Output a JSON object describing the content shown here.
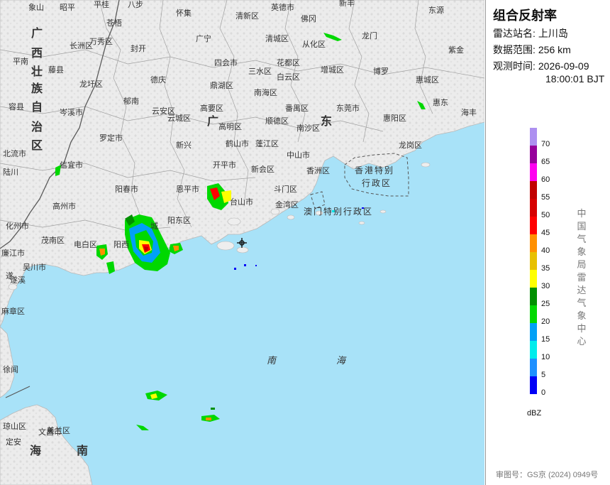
{
  "panel": {
    "title": "组合反射率",
    "station_label": "雷达站名:",
    "station_value": "上川岛",
    "range_label": "数据范围:",
    "range_value": "256 km",
    "time_label": "观测时间:",
    "time_date": "2026-09-09",
    "time_clock": "18:00:01 BJT",
    "legend_values": [
      "70",
      "65",
      "60",
      "55",
      "50",
      "45",
      "40",
      "35",
      "30",
      "25",
      "20",
      "15",
      "10",
      "5",
      "0"
    ],
    "legend_colors": [
      "#ad90f0",
      "#96009b",
      "#ff00f0",
      "#c10000",
      "#d60000",
      "#ff0000",
      "#ff9000",
      "#e7c000",
      "#ffff00",
      "#009000",
      "#00d800",
      "#01a0f6",
      "#00ecec",
      "#1e90ff",
      "#0000f6"
    ],
    "unit": "dBZ",
    "credit": "中国气象局雷达气象中心",
    "approval": "审图号：GS京 (2024) 0949号"
  },
  "map": {
    "colors": {
      "land": "#eeeeee",
      "sea": "#a8e2f8",
      "border": "#888888",
      "province_border": "#5a5a5a"
    },
    "labels": [
      {
        "text": "象山",
        "kind": "city"
      },
      {
        "text": "昭平",
        "kind": "city"
      },
      {
        "text": "平桂",
        "kind": "city"
      },
      {
        "text": "八步",
        "kind": "city"
      },
      {
        "text": "怀集",
        "kind": "city"
      },
      {
        "text": "清新区",
        "kind": "city"
      },
      {
        "text": "英德市",
        "kind": "city"
      },
      {
        "text": "新丰",
        "kind": "city"
      },
      {
        "text": "东源",
        "kind": "city"
      },
      {
        "text": "苍梧",
        "kind": "city"
      },
      {
        "text": "佛冈",
        "kind": "city"
      },
      {
        "text": "长洲区",
        "kind": "city"
      },
      {
        "text": "万秀区",
        "kind": "city"
      },
      {
        "text": "封开",
        "kind": "city"
      },
      {
        "text": "广宁",
        "kind": "city"
      },
      {
        "text": "清城区",
        "kind": "city"
      },
      {
        "text": "从化区",
        "kind": "city"
      },
      {
        "text": "龙门",
        "kind": "city"
      },
      {
        "text": "紫金",
        "kind": "city"
      },
      {
        "text": "平南",
        "kind": "city"
      },
      {
        "text": "藤县",
        "kind": "city"
      },
      {
        "text": "四会市",
        "kind": "city"
      },
      {
        "text": "三水区",
        "kind": "city"
      },
      {
        "text": "花都区",
        "kind": "city"
      },
      {
        "text": "白云区",
        "kind": "city"
      },
      {
        "text": "增城区",
        "kind": "city"
      },
      {
        "text": "博罗",
        "kind": "city"
      },
      {
        "text": "惠城区",
        "kind": "city"
      },
      {
        "text": "龙圩区",
        "kind": "city"
      },
      {
        "text": "德庆",
        "kind": "city"
      },
      {
        "text": "鼎湖区",
        "kind": "city"
      },
      {
        "text": "南海区",
        "kind": "city"
      },
      {
        "text": "郁南",
        "kind": "city"
      },
      {
        "text": "云安区",
        "kind": "city"
      },
      {
        "text": "高要区",
        "kind": "city"
      },
      {
        "text": "番禺区",
        "kind": "city"
      },
      {
        "text": "东莞市",
        "kind": "city"
      },
      {
        "text": "惠东",
        "kind": "city"
      },
      {
        "text": "容县",
        "kind": "city"
      },
      {
        "text": "岑溪市",
        "kind": "city"
      },
      {
        "text": "云城区",
        "kind": "city"
      },
      {
        "text": "高明区",
        "kind": "city"
      },
      {
        "text": "顺德区",
        "kind": "city"
      },
      {
        "text": "南沙区",
        "kind": "city"
      },
      {
        "text": "惠阳区",
        "kind": "city"
      },
      {
        "text": "海丰",
        "kind": "city"
      },
      {
        "text": "罗定市",
        "kind": "city"
      },
      {
        "text": "新兴",
        "kind": "city"
      },
      {
        "text": "鹤山市",
        "kind": "city"
      },
      {
        "text": "蓬江区",
        "kind": "city"
      },
      {
        "text": "中山市",
        "kind": "city"
      },
      {
        "text": "龙岗区",
        "kind": "city"
      },
      {
        "text": "北流市",
        "kind": "city"
      },
      {
        "text": "信宜市",
        "kind": "city"
      },
      {
        "text": "开平市",
        "kind": "city"
      },
      {
        "text": "新会区",
        "kind": "city"
      },
      {
        "text": "香洲区",
        "kind": "city"
      },
      {
        "text": "陆川",
        "kind": "city"
      },
      {
        "text": "阳春市",
        "kind": "city"
      },
      {
        "text": "恩平市",
        "kind": "city"
      },
      {
        "text": "斗门区",
        "kind": "city"
      },
      {
        "text": "高州市",
        "kind": "city"
      },
      {
        "text": "台山市",
        "kind": "city"
      },
      {
        "text": "金湾区",
        "kind": "city"
      },
      {
        "text": "化州市",
        "kind": "city"
      },
      {
        "text": "阳东区",
        "kind": "city"
      },
      {
        "text": "茂南区",
        "kind": "city"
      },
      {
        "text": "电白区",
        "kind": "city"
      },
      {
        "text": "阳西",
        "kind": "city"
      },
      {
        "text": "廉江市",
        "kind": "city"
      },
      {
        "text": "吴川市",
        "kind": "city"
      },
      {
        "text": "麻章区",
        "kind": "city"
      },
      {
        "text": "徐闻",
        "kind": "city"
      },
      {
        "text": "美兰区",
        "kind": "city"
      },
      {
        "text": "文昌市",
        "kind": "city"
      },
      {
        "text": "琼山区",
        "kind": "city"
      },
      {
        "text": "定安",
        "kind": "city"
      },
      {
        "text": "广西壮族自治区",
        "kind": "province"
      },
      {
        "text": "广东",
        "kind": "province"
      },
      {
        "text": "海南",
        "kind": "province"
      },
      {
        "text": "香港特别行政区",
        "kind": "sar"
      },
      {
        "text": "澳门特别行政区",
        "kind": "sar"
      },
      {
        "text": "南海",
        "kind": "sea"
      },
      {
        "text": "城",
        "kind": "city"
      },
      {
        "text": "遂",
        "kind": "city"
      },
      {
        "text": "遂溪",
        "kind": "city"
      }
    ]
  }
}
